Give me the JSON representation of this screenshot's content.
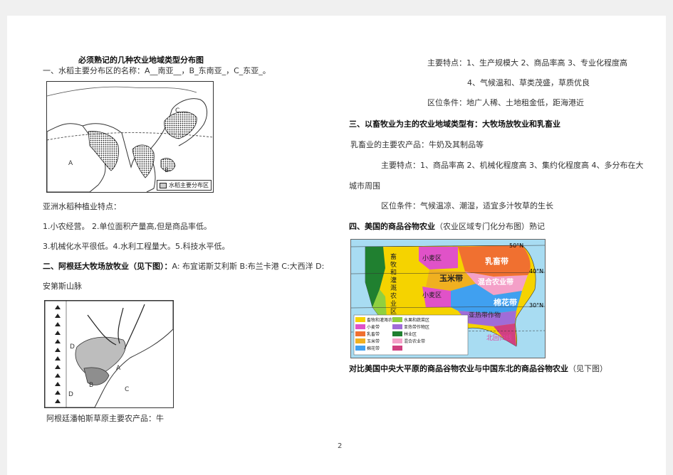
{
  "page_number": "2",
  "left": {
    "title": "必须熟记的几种农业地域类型分布图",
    "rice": {
      "heading": "一、水稻主要分布区的名称：A__南亚__，B_东南亚_，C_东亚_。",
      "map_legend": "水稻主要分布区",
      "map_labels": {
        "a": "A",
        "b": "B",
        "c": "C"
      },
      "features_title": "亚洲水稻种植业特点：",
      "line1": "1.小农经营。  2.单位面积产量高,但是商品率低。",
      "line2": "3.机械化水平很低。4.水利工程量大。5.科技水平低。"
    },
    "argentina": {
      "heading_bold": "二、阿根廷大牧场放牧业（见下图）：",
      "heading_rest": "A: 布宜诺斯艾利斯  B:布兰卡港  C:大西洋  D:",
      "heading_line2": "安第斯山脉",
      "map_labels": {
        "a": "A",
        "b": "B",
        "c": "C",
        "d": "D",
        "d2": "D"
      },
      "caption": "阿根廷潘帕斯草原主要农产品：牛"
    }
  },
  "right": {
    "features": "主要特点：1、生产规模大 2、商品率高 3、专业化程度高",
    "features2": "4、气候温和、草类茂盛，草质优良",
    "location": "区位条件：地广人稀、土地租金低，距海港近",
    "livestock_heading": "三、以畜牧业为主的农业地域类型有：大牧场放牧业和乳畜业",
    "dairy_products": "乳畜业的主要农产品：牛奶及其制品等",
    "dairy_features": "主要特点：1、商品率高 2、机械化程度高 3、集约化程度高 4、多分布在大",
    "dairy_features2": "城市周围",
    "dairy_location": "区位条件：气候温凉、潮湿，适宜多汁牧草的生长",
    "usa_heading_bold": "四、美国的商品谷物农业",
    "usa_heading_rest": "（农业区域专门化分布图）熟记",
    "compare_bold": "对比美国中央大平原的商品谷物农业与中国东北的商品谷物农业",
    "compare_rest": "（见下图）",
    "usa_map": {
      "lat_50": "50°N",
      "lat_40": "40°N",
      "lat_30": "30°N",
      "belt_wheat": "小麦区",
      "belt_dairy": "乳畜带",
      "belt_corn": "玉米带",
      "belt_mixed": "混合农业带",
      "belt_cotton": "棉花带",
      "belt_subtropical": "亚热带作物",
      "belt_wheat2": "小麦区",
      "ranch": "畜牧和灌溉农业区",
      "tropic": "北回归线",
      "legend": [
        {
          "label": "畜牧和灌溉农业区",
          "color": "#f5d300"
        },
        {
          "label": "小麦带",
          "color": "#e052c8"
        },
        {
          "label": "乳畜带",
          "color": "#f07030"
        },
        {
          "label": "玉米带",
          "color": "#f0b020"
        },
        {
          "label": "棉花带",
          "color": "#40a0f0"
        },
        {
          "label": "水果和蔬菜区",
          "color": "#90d040"
        },
        {
          "label": "亚热带作物区",
          "color": "#a06cd8"
        },
        {
          "label": "林业区",
          "color": "#208030"
        },
        {
          "label": "混合农业带",
          "color": "#f4a0c8"
        },
        {
          "label": "",
          "color": "#d04080"
        }
      ]
    }
  }
}
